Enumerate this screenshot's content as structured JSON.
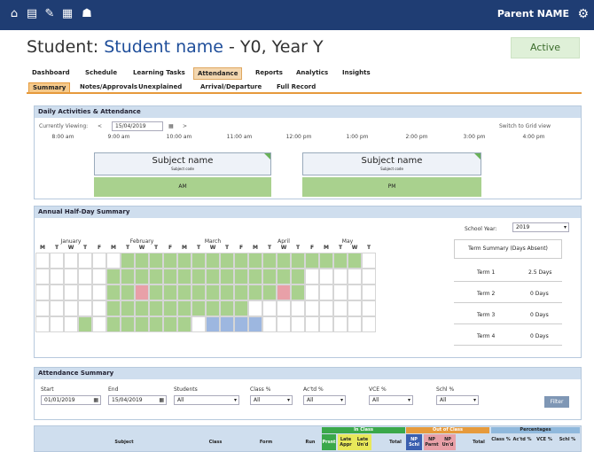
{
  "top": {
    "user": "Parent NAME",
    "icons": [
      "home-icon",
      "calendar-icon",
      "pencil-icon",
      "grid-icon",
      "people-icon"
    ]
  },
  "student": {
    "prefix": "Student: ",
    "name": "Student name",
    "suffix": " - Y0, Year Y",
    "status": "Active"
  },
  "tabs": [
    "Dashboard",
    "Schedule",
    "Learning Tasks",
    "Attendance",
    "Reports",
    "Analytics",
    "Insights"
  ],
  "subtabs": [
    "Summary",
    "Notes/Approvals",
    "Unexplained",
    "Arrival/Departure",
    "Full Record"
  ],
  "daily": {
    "title": "Daily Activities & Attendance",
    "viewing_label": "Currently Viewing:",
    "date": "15/04/2019",
    "switch": "Switch to Grid view",
    "times": [
      "8:00 am",
      "9:00 am",
      "10:00 am",
      "11:00 am",
      "12:00 pm",
      "1:00 pm",
      "2:00 pm",
      "3:00 pm",
      "4:00 pm"
    ],
    "blocks": [
      {
        "name": "Subject name",
        "code": "Subject code",
        "slot": "AM"
      },
      {
        "name": "Subject name",
        "code": "Subject code",
        "slot": "PM"
      }
    ]
  },
  "annual": {
    "title": "Annual Half-Day Summary",
    "year_label": "School Year:",
    "year": "2019",
    "months": [
      "January",
      "February",
      "March",
      "April",
      "May"
    ],
    "days": [
      "M",
      "T",
      "W",
      "T",
      "F"
    ],
    "term_head": "Term Summary (Days Absent)",
    "terms": [
      {
        "t": "Term 1",
        "v": "2.5 Days"
      },
      {
        "t": "Term 2",
        "v": "0 Days"
      },
      {
        "t": "Term 3",
        "v": "0 Days"
      },
      {
        "t": "Term 4",
        "v": "0 Days"
      }
    ]
  },
  "summary": {
    "title": "Attendance Summary",
    "fields": [
      {
        "label": "Start",
        "value": "01/01/2019"
      },
      {
        "label": "End",
        "value": "15/04/2019"
      },
      {
        "label": "Students",
        "value": "All"
      },
      {
        "label": "Class %",
        "value": "All"
      },
      {
        "label": "Ac'td %",
        "value": "All"
      },
      {
        "label": "VCE %",
        "value": "All"
      },
      {
        "label": "Schl %",
        "value": "All"
      }
    ],
    "filter": "Filter"
  },
  "table": {
    "cols": [
      "Subject",
      "Class",
      "Form",
      "Run",
      "Prsnt"
    ],
    "groups": {
      "in": "In Class",
      "out": "Out of Class",
      "pct": "Percentages"
    },
    "in_cols": [
      "Late Appr",
      "Late Un'd",
      "Total"
    ],
    "out_cols": [
      "NP Schl",
      "NP Parnt",
      "NP Un'd",
      "Total"
    ],
    "pct_cols": [
      "Class %",
      "Ac'td %",
      "VCE %",
      "Schl %"
    ]
  },
  "colors": {
    "bar": "#1f3d73",
    "green": "#a9d18e",
    "pink": "#e8a0a8",
    "blue": "#9db7e0",
    "orange": "#e69a3c"
  }
}
